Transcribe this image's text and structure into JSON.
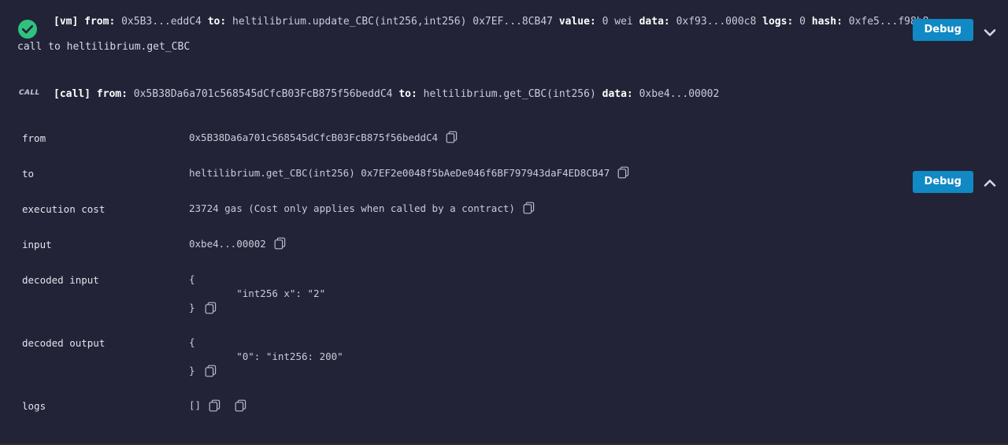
{
  "theme": {
    "background": "#222336",
    "accent_button": "#1089c4",
    "success_green": "#2ec27e",
    "text_primary": "#ffffff",
    "text_secondary": "#c9ccda"
  },
  "transaction": {
    "status_icon": "success-check-icon",
    "vm_tag": "[vm]",
    "fields": [
      {
        "key": "from:",
        "value": "0x5B3...eddC4"
      },
      {
        "key": "to:",
        "value": "heltilibrium.update_CBC(int256,int256) 0x7EF...8CB47"
      },
      {
        "key": "value:",
        "value": "0 wei"
      },
      {
        "key": "data:",
        "value": "0xf93...000c8"
      },
      {
        "key": "logs:",
        "value": "0"
      },
      {
        "key": "hash:",
        "value": "0xfe5...f98b8"
      }
    ],
    "sub_line": "call to heltilibrium.get_CBC",
    "debug_label": "Debug",
    "toggle_icon": "chevron-down-icon"
  },
  "call": {
    "badge": "CALL",
    "tag": "[call]",
    "fields": [
      {
        "key": "from:",
        "value": "0x5B38Da6a701c568545dCfcB03FcB875f56beddC4"
      },
      {
        "key": "to:",
        "value": "heltilibrium.get_CBC(int256)"
      },
      {
        "key": "data:",
        "value": "0xbe4...00002"
      }
    ],
    "debug_label": "Debug",
    "toggle_icon": "chevron-up-icon",
    "details": [
      {
        "label": "from",
        "value": "0x5B38Da6a701c568545dCfcB03FcB875f56beddC4",
        "copy": "copy-icon"
      },
      {
        "label": "to",
        "value": "heltilibrium.get_CBC(int256) 0x7EF2e0048f5bAeDe046f6BF797943daF4ED8CB47",
        "copy": "copy-icon"
      },
      {
        "label": "execution cost",
        "value": "23724 gas (Cost only applies when called by a contract)",
        "copy": "copy-icon"
      },
      {
        "label": "input",
        "value": "0xbe4...00002",
        "copy": "copy-icon"
      }
    ],
    "decoded_input": {
      "label": "decoded input",
      "open_brace": "{",
      "body": "        \"int256 x\": \"2\"",
      "close_brace": "}",
      "copy": "copy-icon"
    },
    "decoded_output": {
      "label": "decoded output",
      "open_brace": "{",
      "body": "        \"0\": \"int256: 200\"",
      "close_brace": "}",
      "copy": "copy-icon"
    },
    "logs": {
      "label": "logs",
      "value": "[]",
      "copy_1": "copy-icon",
      "copy_2": "copy-icon"
    }
  }
}
